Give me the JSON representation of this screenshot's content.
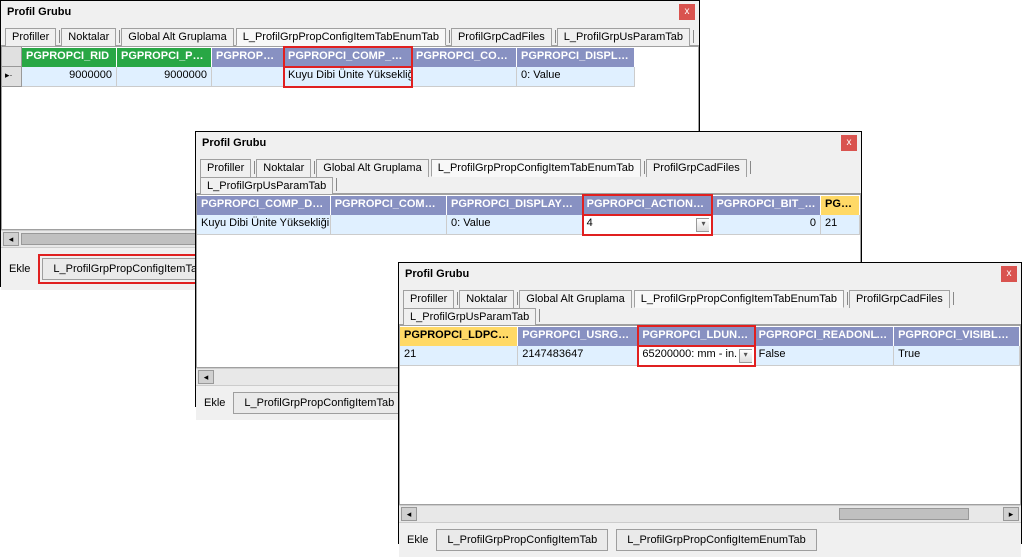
{
  "common": {
    "window_title": "Profil Grubu",
    "close_x": "x",
    "ekle": "Ekle",
    "btn_config_item": "L_ProfilGrpPropConfigItemTab",
    "btn_config_enum": "L_ProfilGrpPropConfigItemEnumTab",
    "tabs": {
      "profiller": "Profiller",
      "noktalar": "Noktalar",
      "global": "Global Alt Gruplama",
      "config_enum": "L_ProfilGrpPropConfigItemTabEnumTab",
      "cad": "ProfilGrpCadFiles",
      "usparam": "L_ProfilGrpUsParamTab"
    }
  },
  "win1": {
    "headers": [
      "PGPROPCI_RID",
      "PGPROPCI_PG_RID",
      "PGPROPCI_D",
      "PGPROPCI_COMP_DESC",
      "PGPROPCI_COMP_VAL",
      "PGPROPCI_DISPLAY_TYPE"
    ],
    "row": [
      "9000000",
      "9000000",
      "",
      "Kuyu Dibi Ünite Yüksekliği",
      "",
      "0: Value"
    ]
  },
  "win2": {
    "headers": [
      "PGPROPCI_COMP_DESC",
      "PGPROPCI_COMP_VAL",
      "PGPROPCI_DISPLAY_TYPE",
      "PGPROPCI_ACTION_MODE",
      "PGPROPCI_BIT_MASK",
      "PGPRO"
    ],
    "row": [
      "Kuyu Dibi Ünite Yüksekliği",
      "",
      "0: Value",
      "4",
      "0",
      "21"
    ]
  },
  "win3": {
    "headers": [
      "PGPROPCI_LDPCAT_RID",
      "PGPROPCI_USRGRP_BITS",
      "PGPROPCI_LDUNIT_RID",
      "PGPROPCI_READONLY_RULE",
      "PGPROPCI_VISIBLE_RULE"
    ],
    "row": [
      "21",
      "2147483647",
      "65200000: mm - in.",
      "False",
      "True"
    ]
  },
  "chart_data": []
}
